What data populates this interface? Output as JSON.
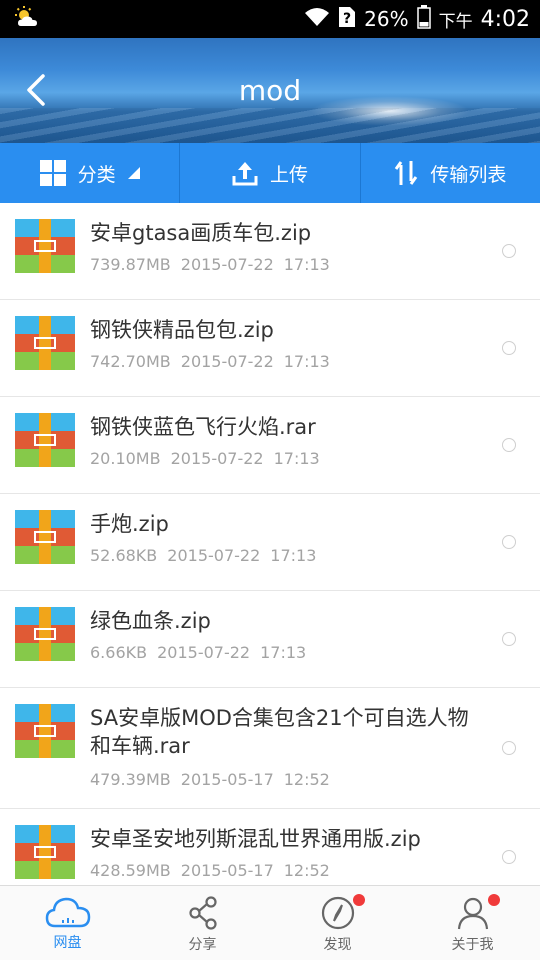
{
  "status_bar": {
    "battery": "26%",
    "ampm": "下午",
    "time": "4:02"
  },
  "header": {
    "title": "mod"
  },
  "toolbar": {
    "category_label": "分类",
    "upload_label": "上传",
    "transfer_label": "传输列表"
  },
  "files": [
    {
      "name": "安卓gtasa画质车包.zip",
      "size": "739.87MB",
      "date": "2015-07-22",
      "time": "17:13"
    },
    {
      "name": "钢铁侠精品包包.zip",
      "size": "742.70MB",
      "date": "2015-07-22",
      "time": "17:13"
    },
    {
      "name": "钢铁侠蓝色飞行火焰.rar",
      "size": "20.10MB",
      "date": "2015-07-22",
      "time": "17:13"
    },
    {
      "name": "手炮.zip",
      "size": "52.68KB",
      "date": "2015-07-22",
      "time": "17:13"
    },
    {
      "name": "绿色血条.zip",
      "size": "6.66KB",
      "date": "2015-07-22",
      "time": "17:13"
    },
    {
      "name": "SA安卓版MOD合集包含21个可自选人物和车辆.rar",
      "size": "479.39MB",
      "date": "2015-05-17",
      "time": "12:52"
    },
    {
      "name": "安卓圣安地列斯混乱世界通用版.zip",
      "size": "428.59MB",
      "date": "2015-05-17",
      "time": "12:52"
    }
  ],
  "bottom_nav": {
    "items": [
      {
        "label": "网盘",
        "icon": "cloud-icon"
      },
      {
        "label": "分享",
        "icon": "share-icon"
      },
      {
        "label": "发现",
        "icon": "compass-icon"
      },
      {
        "label": "关于我",
        "icon": "user-icon"
      }
    ]
  },
  "colors": {
    "accent": "#2a8ef0",
    "notification_dot": "#f03a3a",
    "archive_icon_top": "#3fb6ea",
    "archive_icon_middle": "#e05a35",
    "archive_icon_bottom": "#86c94a",
    "archive_icon_strap": "#f1a51a"
  }
}
